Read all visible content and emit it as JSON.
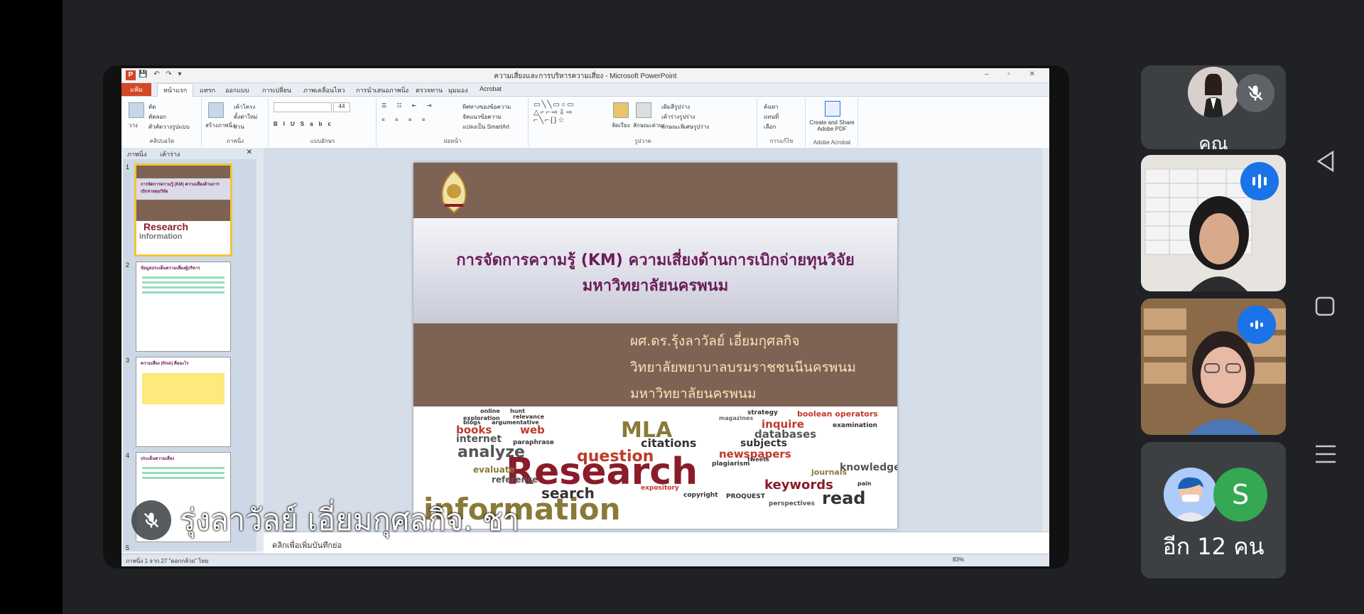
{
  "meeting": {
    "caption_speaker": "รุ่งลาวัลย์ เอี่ยมกุศลกิจ. ชา",
    "participants": [
      {
        "name_partial": "คุณ",
        "mic": "muted"
      },
      {
        "mic": "speaking"
      },
      {
        "mic": "speaking"
      }
    ],
    "more_avatar_letter": "S",
    "more_label": "อีก 12 คน"
  },
  "ppt": {
    "window_title": "ความเสี่ยงและการบริหารความเสี่ยง - Microsoft PowerPoint",
    "app_icon_letter": "P",
    "tabs": [
      "แฟ้ม",
      "หน้าแรก",
      "แทรก",
      "ออกแบบ",
      "การเปลี่ยน",
      "ภาพเคลื่อนไหว",
      "การนำเสนอภาพนิ่ง",
      "ตรวจทาน",
      "มุมมอง",
      "Acrobat"
    ],
    "ribbon": {
      "clipboard": {
        "label": "คลิปบอร์ด",
        "paste": "วาง",
        "cut": "ตัด",
        "copy": "คัดลอก",
        "format_painter": "ตัวคัดวางรูปแบบ"
      },
      "slides": {
        "label": "ภาพนิ่ง",
        "new_slide": "สร้างภาพนิ่ง",
        "layout": "เค้าโครง",
        "reset": "ตั้งค่าใหม่",
        "section": "ส่วน"
      },
      "font": {
        "label": "แบบอักษร",
        "size": "44"
      },
      "paragraph": {
        "label": "ย่อหน้า",
        "text_direction": "ทิศทางของข้อความ",
        "align_text": "จัดแนวข้อความ",
        "smartart": "แปลงเป็น SmartArt"
      },
      "drawing": {
        "label": "รูปวาด",
        "arrange": "จัดเรียง",
        "quick_styles": "ลักษณะด่วน",
        "shape_fill": "เติมสีรูปร่าง",
        "shape_outline": "เค้าร่างรูปร่าง",
        "shape_effects": "ลักษณะพิเศษรูปร่าง"
      },
      "editing": {
        "label": "การแก้ไข",
        "find": "ค้นหา",
        "replace": "แทนที่",
        "select": "เลือก"
      },
      "acrobat": {
        "label": "Adobe Acrobat",
        "create": "Create and Share Adobe PDF"
      }
    },
    "pane_tabs": [
      "ภาพนิ่ง",
      "เค้าร่าง"
    ],
    "thumbnails": [
      {
        "num": "1",
        "title": "การจัดการความรู้ (KM) ความเสี่ยงด้านการเบิกจ่ายทุนวิจัย"
      },
      {
        "num": "2",
        "title": "ข้อมูลประเด็นความเสี่ยงผู้บริหาร"
      },
      {
        "num": "3",
        "title": "ความเสี่ยง (Risk) คืออะไร"
      },
      {
        "num": "4",
        "title": "ประเด็นความเสี่ยง"
      },
      {
        "num": "5",
        "title": ""
      }
    ],
    "notes_placeholder": "คลิกเพื่อเพิ่มบันทึกย่อ",
    "status_left": "ภาพนิ่ง 1 จาก 27   \"ดอกกล้วย\"   ไทย",
    "zoom": "83%"
  },
  "slide": {
    "title_line1": "การจัดการความรู้ (KM) ความเสี่ยงด้านการเบิกจ่ายทุนวิจัย",
    "title_line2": "มหาวิทยาลัยนครพนม",
    "author_line1": "ผศ.ดร.รุ้งลาวัลย์ เอี่ยมกุศลกิจ",
    "author_line2": "วิทยาลัยพยาบาลบรมราชชนนีนครพนม",
    "author_line3": "มหาวิทยาลัยนครพนม",
    "word_cloud": [
      "Research",
      "information",
      "analyze",
      "question",
      "search",
      "read",
      "keywords",
      "citations",
      "books",
      "web",
      "internet",
      "databases",
      "subjects",
      "newspapers",
      "inquire",
      "MLA",
      "magazines",
      "evaluate",
      "reference",
      "knowledge",
      "journals",
      "strategy",
      "boolean operators",
      "plagiarism",
      "expository",
      "copyright",
      "PROQUEST",
      "perspectives",
      "online",
      "hunt",
      "relevance",
      "exploration",
      "argumentative",
      "blogs",
      "paraphrase",
      "examination",
      "tweets",
      "pain"
    ],
    "colors": {
      "band": "#7e6355",
      "title": "#6b1d5a",
      "author": "#f4e6b6"
    }
  }
}
